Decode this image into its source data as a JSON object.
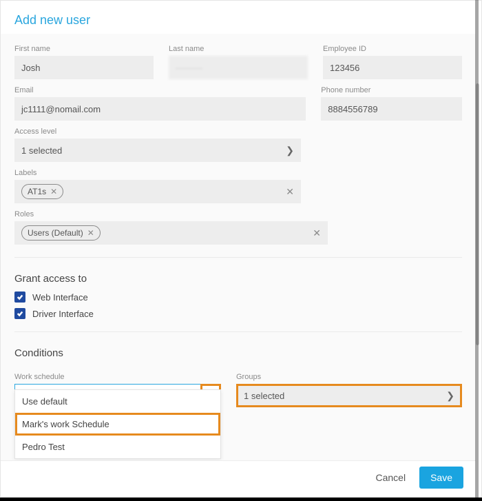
{
  "header": {
    "title": "Add new user"
  },
  "fields": {
    "first_name": {
      "label": "First name",
      "value": "Josh"
    },
    "last_name": {
      "label": "Last name",
      "value": "———"
    },
    "employee_id": {
      "label": "Employee ID",
      "value": "123456"
    },
    "email": {
      "label": "Email",
      "value": "jc1111@nomail.com"
    },
    "phone": {
      "label": "Phone number",
      "value": "8884556789"
    },
    "access_level": {
      "label": "Access level",
      "value": "1 selected"
    },
    "labels_label": "Labels",
    "labels_chip": "AT1s",
    "roles_label": "Roles",
    "roles_chip": "Users (Default)"
  },
  "grant": {
    "heading": "Grant access to",
    "web": {
      "label": "Web Interface",
      "checked": true
    },
    "driver": {
      "label": "Driver Interface",
      "checked": true
    }
  },
  "conditions": {
    "heading": "Conditions",
    "work_schedule": {
      "label": "Work schedule",
      "value": "Use default",
      "options": [
        "Use default",
        "Mark's work Schedule",
        "Pedro Test"
      ],
      "highlighted_index": 1
    },
    "groups": {
      "label": "Groups",
      "value": "1 selected"
    }
  },
  "footer": {
    "cancel": "Cancel",
    "save": "Save"
  }
}
